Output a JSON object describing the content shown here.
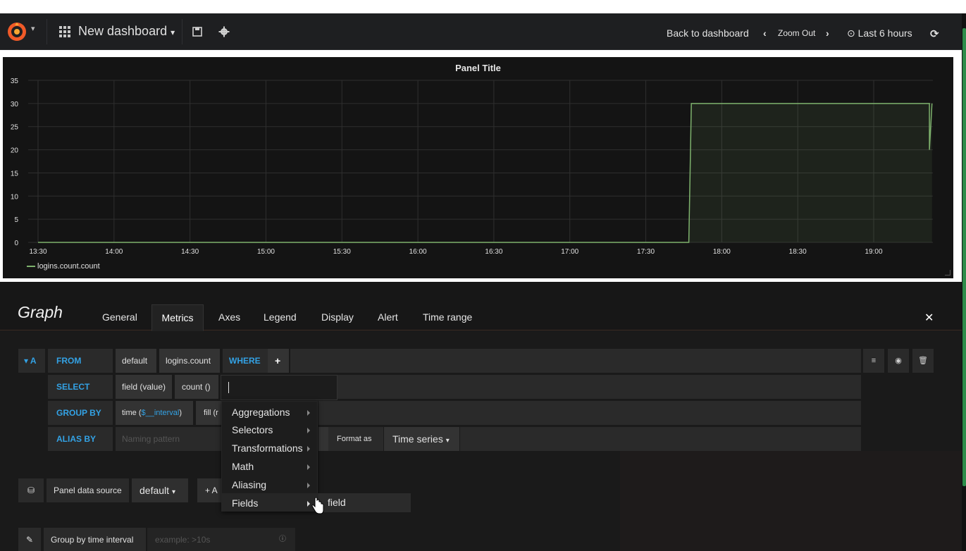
{
  "navbar": {
    "dashboard_title": "New dashboard",
    "back_to_dashboard": "Back to dashboard",
    "zoom_out": "Zoom Out",
    "time_range": "Last 6 hours"
  },
  "panel": {
    "title": "Panel Title",
    "legend": "logins.count.count"
  },
  "chart_data": {
    "type": "area",
    "title": "Panel Title",
    "x": [
      "13:30",
      "14:00",
      "14:30",
      "15:00",
      "15:30",
      "16:00",
      "16:30",
      "17:00",
      "17:30",
      "18:00",
      "18:30",
      "19:00"
    ],
    "y_ticks": [
      0,
      5,
      10,
      15,
      20,
      25,
      30,
      35
    ],
    "ylim": [
      0,
      35
    ],
    "series": [
      {
        "name": "logins.count.count",
        "color": "#7eb26d",
        "points": [
          [
            "13:30",
            0
          ],
          [
            "17:47",
            0
          ],
          [
            "17:48",
            30
          ],
          [
            "19:22",
            30
          ],
          [
            "19:22",
            20
          ],
          [
            "19:23",
            30
          ]
        ]
      }
    ],
    "grid": true,
    "legend_position": "bottom-left"
  },
  "editor": {
    "title": "Graph",
    "tabs": [
      {
        "label": "General",
        "active": false
      },
      {
        "label": "Metrics",
        "active": true
      },
      {
        "label": "Axes",
        "active": false
      },
      {
        "label": "Legend",
        "active": false
      },
      {
        "label": "Display",
        "active": false
      },
      {
        "label": "Alert",
        "active": false
      },
      {
        "label": "Time range",
        "active": false
      }
    ]
  },
  "query": {
    "ref_id": "A",
    "from_label": "FROM",
    "policy": "default",
    "measurement": "logins.count",
    "where_label": "WHERE",
    "select_label": "SELECT",
    "select_field": "field (value)",
    "select_func": "count ()",
    "group_by_label": "GROUP BY",
    "group_time_prefix": "time (",
    "group_time_var": "$__interval",
    "group_time_suffix": ")",
    "group_fill": "fill (r",
    "alias_label": "ALIAS BY",
    "alias_placeholder": "Naming pattern",
    "format_as_label": "Format as",
    "format_as_value": "Time series"
  },
  "dropdown": {
    "items": [
      "Aggregations",
      "Selectors",
      "Transformations",
      "Math",
      "Aliasing",
      "Fields"
    ],
    "submenu_item": "field"
  },
  "datasource": {
    "label": "Panel data source",
    "value": "default",
    "add_label": "+ A"
  },
  "options": {
    "group_interval_label": "Group by time interval",
    "group_interval_placeholder": "example: >10s"
  }
}
